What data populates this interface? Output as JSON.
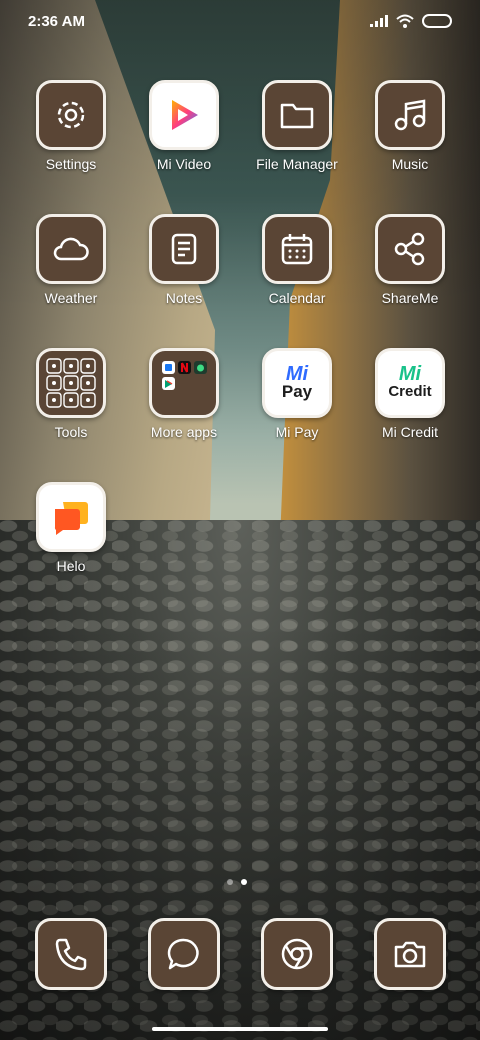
{
  "status_bar": {
    "time": "2:36 AM",
    "icons": [
      "signal-icon",
      "wifi-icon",
      "battery-icon"
    ]
  },
  "apps": [
    {
      "label": "Settings",
      "icon": "gear-icon"
    },
    {
      "label": "Mi Video",
      "icon": "play-icon"
    },
    {
      "label": "File Manager",
      "icon": "folder-icon"
    },
    {
      "label": "Music",
      "icon": "music-note-icon"
    },
    {
      "label": "Weather",
      "icon": "cloud-icon"
    },
    {
      "label": "Notes",
      "icon": "note-icon"
    },
    {
      "label": "Calendar",
      "icon": "calendar-icon"
    },
    {
      "label": "ShareMe",
      "icon": "share-icon"
    },
    {
      "label": "Tools",
      "icon": "tools-folder-icon"
    },
    {
      "label": "More apps",
      "icon": "apps-folder-icon"
    },
    {
      "label": "Mi Pay",
      "icon": "mi-pay-icon",
      "tile_text": [
        "Mi",
        "Pay"
      ]
    },
    {
      "label": "Mi Credit",
      "icon": "mi-credit-icon",
      "tile_text": [
        "Mi",
        "Credit"
      ]
    },
    {
      "label": "Helo",
      "icon": "chat-bubbles-icon"
    }
  ],
  "dock": [
    {
      "name": "phone",
      "icon": "phone-icon"
    },
    {
      "name": "messages",
      "icon": "message-icon"
    },
    {
      "name": "browser",
      "icon": "chrome-icon"
    },
    {
      "name": "camera",
      "icon": "camera-icon"
    }
  ],
  "page_indicator": {
    "pages": 2,
    "current": 2
  },
  "colors": {
    "tile_bg": "#5a4535",
    "tile_border": "#f3efe9",
    "mi_blue": "#2f6bff",
    "mi_green": "#19c28a",
    "helo_orange": "#ff6a1f"
  }
}
